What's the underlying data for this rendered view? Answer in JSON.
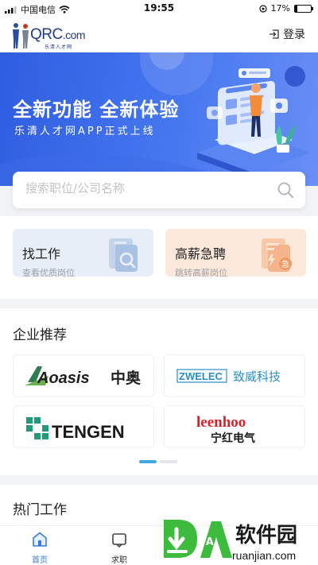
{
  "status_bar": {
    "carrier": "中国电信",
    "time": "19:55",
    "battery": "17%",
    "battery_level": 0.17
  },
  "header": {
    "logo_text": "QRC",
    "logo_domain": ".com",
    "logo_subtitle": "乐清人才网",
    "login_label": "登录",
    "login_icon": "login-icon"
  },
  "banner": {
    "title": "全新功能  全新体验",
    "subtitle": "乐清人才网APP正式上线"
  },
  "search": {
    "placeholder": "搜索职位/公司名称",
    "value": ""
  },
  "quick_cards": [
    {
      "title": "找工作",
      "subtitle": "查看优质岗位",
      "icon": "search-document-icon"
    },
    {
      "title": "高薪急聘",
      "subtitle": "跳转高薪岗位",
      "icon": "urgent-document-icon",
      "badge": "急"
    }
  ],
  "enterprise": {
    "title": "企业推荐",
    "companies": [
      {
        "name": "Aoasis",
        "name_cn": "中奥"
      },
      {
        "name": "ZWELEC",
        "name_cn": "致威科技"
      },
      {
        "name": "TENGEN",
        "name_cn": ""
      },
      {
        "name": "leenhoo",
        "name_cn": "宁红电气"
      }
    ],
    "pages": 2,
    "active_page": 1
  },
  "hot_jobs": {
    "title": "热门工作"
  },
  "tabbar": {
    "items": [
      {
        "label": "首页",
        "icon": "home-icon",
        "active": true
      },
      {
        "label": "求职",
        "icon": "job-seek-icon",
        "active": false
      }
    ]
  },
  "watermark": {
    "text": "软件园",
    "url": "ruanjian.com",
    "mark": "DA"
  },
  "colors": {
    "primary": "#3a7be0",
    "banner_start": "#2f5de0",
    "banner_end": "#6a8ff6",
    "card_blue_bg": "#e7eef7",
    "card_orange_bg": "#fde9dc",
    "watermark_green": "#3dbb3d"
  }
}
